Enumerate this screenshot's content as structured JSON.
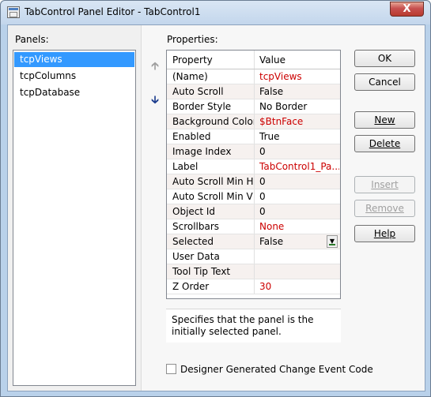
{
  "window": {
    "title": "TabControl Panel Editor - TabControl1",
    "close_glyph": "X"
  },
  "panels": {
    "label": "Panels:",
    "items": [
      "tcpViews",
      "tcpColumns",
      "tcpDatabase"
    ],
    "selected": "tcpViews"
  },
  "reorder": {
    "up_icon": "arrow-up",
    "down_icon": "arrow-down"
  },
  "properties": {
    "label": "Properties:",
    "col_property": "Property",
    "col_value": "Value",
    "rows": [
      {
        "name": "(Name)",
        "value": "tcpViews",
        "value_color": "#cc0000"
      },
      {
        "name": "Auto Scroll",
        "value": "False"
      },
      {
        "name": "Border Style",
        "value": "No Border"
      },
      {
        "name": "Background Color",
        "value": "$BtnFace",
        "value_color": "#cc0000"
      },
      {
        "name": "Enabled",
        "value": "True"
      },
      {
        "name": "Image Index",
        "value": "0"
      },
      {
        "name": "Label",
        "value": "TabControl1_Pa...",
        "value_color": "#cc0000"
      },
      {
        "name": "Auto Scroll Min H",
        "value": "0"
      },
      {
        "name": "Auto Scroll Min V",
        "value": "0"
      },
      {
        "name": "Object Id",
        "value": "0"
      },
      {
        "name": "Scrollbars",
        "value": "None",
        "value_color": "#cc0000"
      },
      {
        "name": "Selected",
        "value": "False"
      },
      {
        "name": "User Data",
        "value": ""
      },
      {
        "name": "Tool Tip Text",
        "value": ""
      },
      {
        "name": "Z Order",
        "value": "30",
        "value_color": "#cc0000"
      }
    ],
    "description": "Specifies that the panel is the initially selected panel."
  },
  "buttons": {
    "ok": "OK",
    "cancel": "Cancel",
    "new": "New",
    "delete": "Delete",
    "insert": "Insert",
    "remove": "Remove",
    "help": "Help"
  },
  "checkbox": {
    "label": "Designer Generated Change Event Code",
    "checked": false
  }
}
